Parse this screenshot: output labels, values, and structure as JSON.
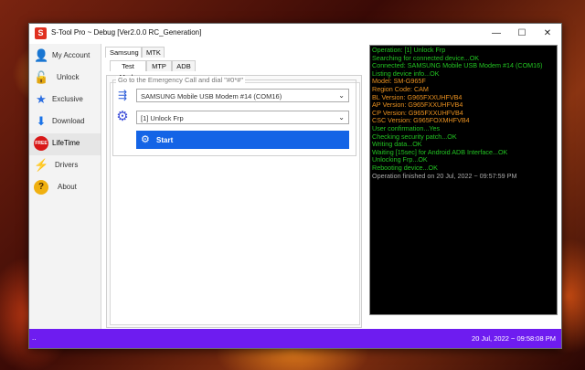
{
  "window": {
    "title": "S-Tool Pro ~ Debug [Ver2.0.0 RC_Generation]",
    "controls": {
      "minimize": "—",
      "maximize": "☐",
      "close": "✕"
    }
  },
  "sidebar": {
    "items": [
      {
        "label": "My Account",
        "icon": "user-icon"
      },
      {
        "label": "Unlock",
        "icon": "unlock-user-icon"
      },
      {
        "label": "Exclusive",
        "icon": "star-icon"
      },
      {
        "label": "Download",
        "icon": "download-icon"
      },
      {
        "label": "LifeTime",
        "icon": "free-badge-icon",
        "badge": "FREE"
      },
      {
        "label": "Drivers",
        "icon": "cables-icon"
      },
      {
        "label": "About",
        "icon": "help-icon"
      }
    ]
  },
  "main": {
    "brand_tabs": [
      "Samsung",
      "MTK"
    ],
    "mode_tabs": [
      "Test Mode",
      "MTP",
      "ADB"
    ],
    "group_label": "Go to the Emergency Call and dial \"#0*#\"",
    "device_select": "SAMSUNG Mobile USB Modem #14 (COM16)",
    "operation_select": "[1] Unlock Frp",
    "start_label": "Start"
  },
  "console": {
    "lines": [
      {
        "parts": [
          {
            "t": "Operation: [1] Unlock Frp",
            "c": "#22c422"
          }
        ]
      },
      {
        "parts": [
          {
            "t": "Searching for connected device...",
            "c": "#22c422"
          },
          {
            "t": "OK",
            "c": "#22c422"
          }
        ]
      },
      {
        "parts": [
          {
            "t": "Connected: SAMSUNG Mobile USB Modem #14 (COM16)",
            "c": "#22c422"
          }
        ]
      },
      {
        "parts": [
          {
            "t": "Listing device info...",
            "c": "#22c422"
          },
          {
            "t": "OK",
            "c": "#22c422"
          }
        ]
      },
      {
        "parts": [
          {
            "t": "  Model: SM-G965F",
            "c": "#e89020"
          }
        ]
      },
      {
        "parts": [
          {
            "t": "  Region Code: CAM",
            "c": "#e89020"
          }
        ]
      },
      {
        "parts": [
          {
            "t": "  BL Version: G965FXXUHFVB4",
            "c": "#e89020"
          }
        ]
      },
      {
        "parts": [
          {
            "t": "  AP Version: G965FXXUHFVB4",
            "c": "#e89020"
          }
        ]
      },
      {
        "parts": [
          {
            "t": "  CP Version: G965FXXUHFVB4",
            "c": "#e89020"
          }
        ]
      },
      {
        "parts": [
          {
            "t": "  CSC Version: G965FOXMHFVB4",
            "c": "#e89020"
          }
        ]
      },
      {
        "parts": [
          {
            "t": "User confirmation...",
            "c": "#22c422"
          },
          {
            "t": "Yes",
            "c": "#22c422"
          }
        ]
      },
      {
        "parts": [
          {
            "t": "Checking security patch...",
            "c": "#22c422"
          },
          {
            "t": "OK",
            "c": "#22c422"
          }
        ]
      },
      {
        "parts": [
          {
            "t": "Writing data...",
            "c": "#22c422"
          },
          {
            "t": "OK",
            "c": "#22c422"
          }
        ]
      },
      {
        "parts": [
          {
            "t": "Waiting [15sec] for Android ADB Interface...",
            "c": "#22c422"
          },
          {
            "t": "OK",
            "c": "#22c422"
          }
        ]
      },
      {
        "parts": [
          {
            "t": "Unlocking Frp...",
            "c": "#22c422"
          },
          {
            "t": "OK",
            "c": "#22c422"
          }
        ]
      },
      {
        "parts": [
          {
            "t": "Rebooting device...",
            "c": "#22c422"
          },
          {
            "t": "OK",
            "c": "#22c422"
          }
        ]
      },
      {
        "parts": [
          {
            "t": "Operation finished on 20 Jul, 2022 ~ 09:57:59 PM",
            "c": "#aaaaaa"
          }
        ]
      }
    ]
  },
  "statusbar": {
    "left": "..",
    "datetime": "20 Jul, 2022 ~ 09:58:08 PM"
  },
  "colors": {
    "accent": "#1464e6",
    "statusbar": "#6e1cf0",
    "console_ok": "#22c422",
    "console_info": "#e89020"
  }
}
